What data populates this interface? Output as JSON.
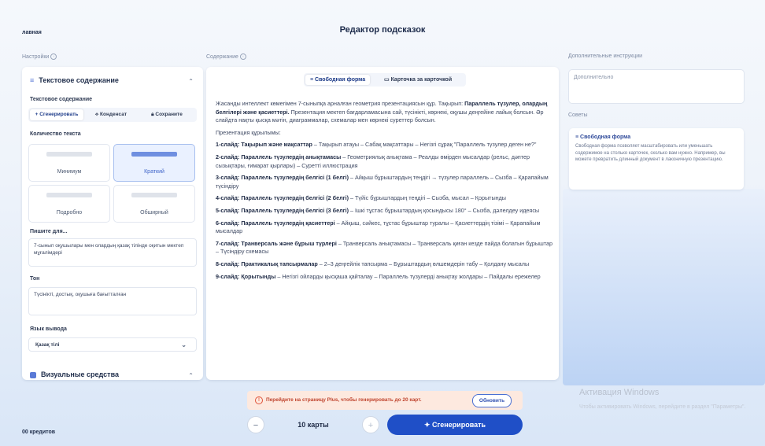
{
  "header": {
    "breadcrumb": "лавная",
    "title": "Редактор подсказок"
  },
  "sections": {
    "settings": "Настройки",
    "content": "Содержание",
    "extra": "Дополнительные инструкции",
    "tips": "Советы"
  },
  "left": {
    "panel_title": "Текстовое содержание",
    "content_label": "Текстовое содержание",
    "modes": [
      "+ Сгенерировать",
      "Конденсат",
      "Сохраните"
    ],
    "amount_label": "Количество текста",
    "amount_options": [
      "Минимум",
      "Краткий",
      "Подробно",
      "Обширный"
    ],
    "write_for_label": "Пишите для...",
    "write_for_value": "7-сынып оқушылары мен олардың қазақ тілінде оқитын мектеп мұғалімдері",
    "tone_label": "Тон",
    "tone_value": "Түсінікті, достық, оқушыға бағытталған",
    "lang_label": "Язык вывода",
    "lang_value": "Қазақ тілі",
    "visual_title": "Визуальные средства"
  },
  "middle": {
    "tabs": [
      "Свободная форма",
      "Карточка за карточкой"
    ],
    "intro": "Жасанды интеллект көмегімен 7-сыныпқа арналған геометрия презентациясын құр. Тақырып:",
    "intro_bold": "Параллель түзулер, олардың белгілері және қасиеттері.",
    "intro_rest": "Презентация мектеп бағдарламасына сай, түсінікті, көрнекі, оқушы деңгейіне лайық болсын. Әр слайдта нақты қысқа мәтін, диаграммалар, схемалар мен көрнекі суреттер болсын.",
    "structure": "Презентация құрылымы:",
    "slides": [
      {
        "b": "1-слайд: Тақырып және мақсаттар",
        "t": " – Тақырып атауы – Сабақ мақсаттары – Негізгі сұрақ \"Параллель түзулер деген не?\""
      },
      {
        "b": "2-слайд: Параллель түзулердің анықтамасы",
        "t": " – Геометриялық анықтама – Реалды өмірден мысалдар (рельс, дәптер сызықтары, ғимарат қырлары) – Суретті иллюстрация"
      },
      {
        "b": "3-слайд: Параллель түзулердің белгісі (1 белгі)",
        "t": " – Айқыш бұрыштардың теңдігі → түзулер параллель – Сызба – Қарапайым түсіндіру"
      },
      {
        "b": "4-слайд: Параллель түзулердің белгісі (2 белгі)",
        "t": " – Түйіс бұрыштардың теңдігі – Сызба, мысал – Қорытынды"
      },
      {
        "b": "5-слайд: Параллель түзулердің белгісі (3 белгі)",
        "t": " – Ішкі тұстас бұрыштардың қосындысы 180° – Сызба, дәлелдеу идеясы"
      },
      {
        "b": "6-слайд: Параллель түзулердің қасиеттері",
        "t": " – Айқыш, сәйкес, тұстас бұрыштар туралы – Қасиеттердің тізімі – Қарапайым мысалдар"
      },
      {
        "b": "7-слайд: Транверсаль және бұрыш түрлері",
        "t": " – Транверсаль анықтамасы – Транверсаль қиған кезде пайда болатын бұрыштар – Түсіндіру схемасы"
      },
      {
        "b": "8-слайд: Практикалық тапсырмалар",
        "t": " – 2–3 деңгейлік тапсырма – Бұрыштардың өлшемдерін табу – Қолдану мысалы"
      },
      {
        "b": "9-слайд: Қорытынды",
        "t": " – Негізгі ойларды қысқаша қайталау – Параллель түзулерді анықтау жолдары – Пайдалы ережелер"
      }
    ]
  },
  "right": {
    "extra_placeholder": "Дополнительно",
    "tip_title": "Свободная форма",
    "tip_text": "Свободная форма позволяет масштабировать или уменьшать содержимое на столько карточек, сколько вам нужно. Например, вы можете превратить длинный документ в лаконичную презентацию."
  },
  "footer": {
    "warning": "Перейдите на страницу Plus, чтобы генерировать до 20 карт.",
    "upgrade": "Обновить",
    "credits": "00 кредитов",
    "minus": "−",
    "plus": "+",
    "card_count": "10 карты",
    "generate": "✦ Сгенерировать"
  },
  "watermark": {
    "title": "Активация Windows",
    "text": "Чтобы активировать Windows, перейдите в раздел \"Параметры\"."
  },
  "colors": {
    "accent": "#1f4fc7",
    "warning_bg": "#fde9df",
    "warning_text": "#c0452f"
  }
}
